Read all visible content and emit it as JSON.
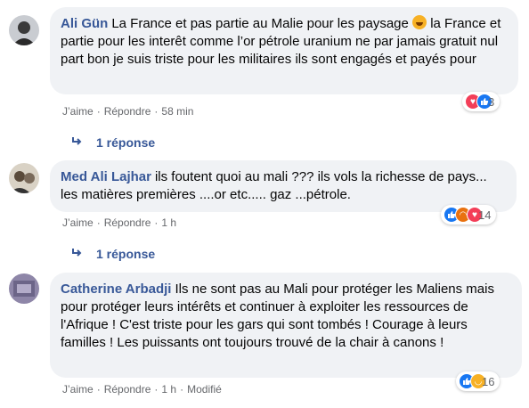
{
  "colors": {
    "author": "#385898",
    "bubble": "#f0f2f5",
    "meta": "#65676b"
  },
  "comments": [
    {
      "author": "Ali Gün",
      "text_before": "La France et pas partie au Malie pour les paysage",
      "emoji": "rolling-on-floor-laughing-emoji",
      "text_after": "la France et partie pour les interêt comme l’or pétrole uranium ne par jamais gratuit nul part bon je suis triste pour les militaires ils sont engagés et payés pour",
      "like_label": "J’aime",
      "reply_label": "Répondre",
      "time": "58 min",
      "edited": "",
      "reaction_icons": [
        "love-icon",
        "like-icon"
      ],
      "reaction_count": "3",
      "replies_label": "1 réponse"
    },
    {
      "author": "Med Ali Lajhar",
      "text": "ils foutent quoi au mali ??? ils vols la richesse de pays... les matières premières ....or etc..... gaz ...pétrole.",
      "like_label": "J’aime",
      "reply_label": "Répondre",
      "time": "1 h",
      "reaction_icons": [
        "like-icon",
        "angry-icon",
        "love-icon"
      ],
      "reaction_count": "14",
      "replies_label": "1 réponse"
    },
    {
      "author": "Catherine Arbadji",
      "text": "Ils ne sont pas au Mali pour protéger les Maliens mais pour protéger leurs intérêts et continuer à exploiter les ressources de l'Afrique ! C'est triste pour les gars qui sont tombés ! Courage à leurs familles ! Les puissants ont toujours trouvé de la chair à canons !",
      "like_label": "J’aime",
      "reply_label": "Répondre",
      "time": "1 h",
      "edited": "Modifié",
      "reaction_icons": [
        "like-icon",
        "sad-icon"
      ],
      "reaction_count": "16"
    }
  ]
}
